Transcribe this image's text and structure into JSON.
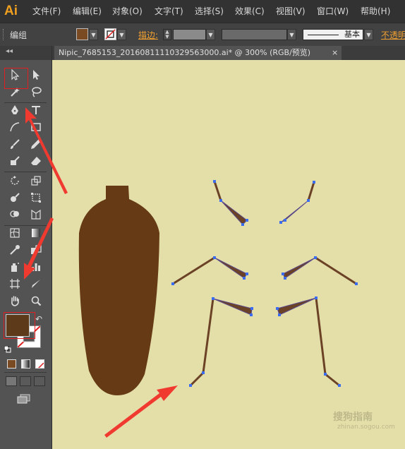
{
  "app": {
    "logo": "Ai",
    "accent_color": "#f0a020"
  },
  "menubar": {
    "items": [
      "文件(F)",
      "编辑(E)",
      "对象(O)",
      "文字(T)",
      "选择(S)",
      "效果(C)",
      "视图(V)",
      "窗口(W)",
      "帮助(H)"
    ]
  },
  "control_bar": {
    "selection_label": "编组",
    "fill_color": "#7a4a22",
    "stroke_label": "描边:",
    "brush_label": "基本",
    "opacity_label": "不透明"
  },
  "document": {
    "tab_title": "Nipic_7685153_20160811110329563000.ai*  @  300% (RGB/预览)",
    "close_glyph": "×",
    "canvas_color": "#e4dfa9"
  },
  "toolbox": {
    "fill_color": "#5c3a1a",
    "tools": [
      "selection-tool",
      "direct-selection-tool",
      "magic-wand-tool",
      "lasso-tool",
      "pen-tool",
      "type-tool",
      "line-tool",
      "rectangle-tool",
      "paintbrush-tool",
      "pencil-tool",
      "blob-brush-tool",
      "eraser-tool",
      "rotate-tool",
      "scale-tool",
      "warp-tool",
      "free-transform-tool",
      "shape-builder-tool",
      "perspective-grid-tool",
      "mesh-tool",
      "gradient-tool",
      "eyedropper-tool",
      "blend-tool",
      "symbol-sprayer-tool",
      "column-graph-tool",
      "artboard-tool",
      "slice-tool",
      "hand-tool",
      "zoom-tool"
    ]
  },
  "artwork": {
    "body_color": "#653a14",
    "leg_color": "#6b4226",
    "anchor_color": "#3b6cf0",
    "arrow_color": "#f03a30"
  },
  "watermark": {
    "text": "搜狗指南",
    "sub": "zhinan.sogou.com"
  }
}
